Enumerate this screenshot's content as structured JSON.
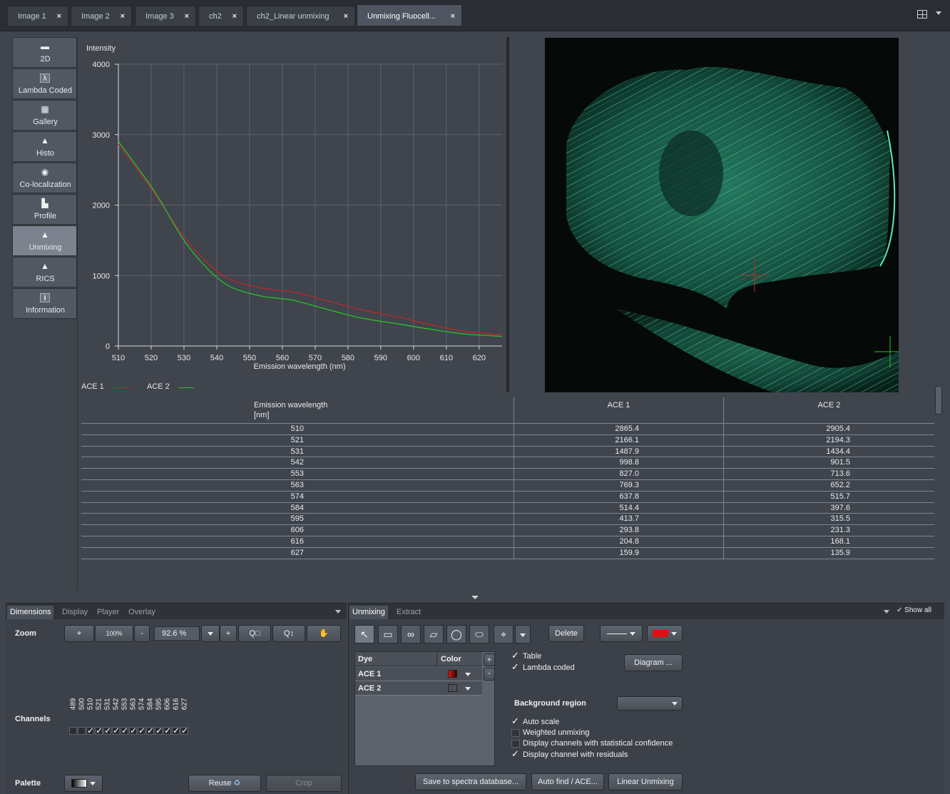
{
  "tabs": [
    {
      "label": "Image 1",
      "close": "×"
    },
    {
      "label": "Image 2",
      "close": "×"
    },
    {
      "label": "Image 3",
      "close": "×"
    },
    {
      "label": "ch2",
      "close": "×"
    },
    {
      "label": "ch2_Linear unmixing",
      "close": "×"
    },
    {
      "label": "Unmixing Fluocell...",
      "close": "×"
    }
  ],
  "view_tabs": [
    {
      "label": "2D",
      "icon": "▬"
    },
    {
      "label": "Lambda Coded",
      "icon": "λ"
    },
    {
      "label": "Gallery",
      "icon": "▦"
    },
    {
      "label": "Histo",
      "icon": "▲"
    },
    {
      "label": "Co-localization",
      "icon": "◉"
    },
    {
      "label": "Profile",
      "icon": "▙"
    },
    {
      "label": "Unmixing",
      "icon": "▲"
    },
    {
      "label": "RICS",
      "icon": "▲"
    },
    {
      "label": "Information",
      "icon": "i"
    }
  ],
  "chart_data": {
    "type": "line",
    "ylabel": "Intensity",
    "xlabel": "Emission wavelength (nm)",
    "xlim": [
      510,
      627
    ],
    "ylim": [
      0,
      4000
    ],
    "xticks": [
      510,
      520,
      530,
      540,
      550,
      560,
      570,
      580,
      590,
      600,
      610,
      620
    ],
    "yticks": [
      0,
      1000,
      2000,
      3000,
      4000
    ],
    "grid": true,
    "legend": "bottom-left",
    "x": [
      510,
      521,
      531,
      542,
      553,
      563,
      574,
      584,
      595,
      606,
      616,
      627
    ],
    "series": [
      {
        "name": "ACE 1",
        "color": "#c0262c",
        "values": [
          2865.4,
          2166.1,
          1487.9,
          998.8,
          827.0,
          769.3,
          637.8,
          514.4,
          413.7,
          293.8,
          204.8,
          159.9
        ]
      },
      {
        "name": "ACE 2",
        "color": "#27c227",
        "values": [
          2905.4,
          2194.3,
          1434.4,
          901.5,
          713.6,
          652.2,
          515.7,
          397.6,
          315.5,
          231.3,
          168.1,
          135.9
        ]
      }
    ]
  },
  "table": {
    "headers": [
      "Emission wavelength",
      "[nm]",
      "ACE 1",
      "ACE 2"
    ],
    "rows": [
      [
        "510",
        "2865.4",
        "2905.4"
      ],
      [
        "521",
        "2166.1",
        "2194.3"
      ],
      [
        "531",
        "1487.9",
        "1434.4"
      ],
      [
        "542",
        "998.8",
        "901.5"
      ],
      [
        "553",
        "827.0",
        "713.6"
      ],
      [
        "563",
        "769.3",
        "652.2"
      ],
      [
        "574",
        "637.8",
        "515.7"
      ],
      [
        "584",
        "514.4",
        "397.6"
      ],
      [
        "595",
        "413.7",
        "315.5"
      ],
      [
        "606",
        "293.8",
        "231.3"
      ],
      [
        "616",
        "204.8",
        "168.1"
      ],
      [
        "627",
        "159.9",
        "135.9"
      ]
    ]
  },
  "left_panel": {
    "tabs": [
      "Dimensions",
      "Display",
      "Player",
      "Overlay"
    ],
    "zoom_label": "Zoom",
    "zoom_100": "100%",
    "zoom_minus": "-",
    "zoom_value": "92.6 %",
    "zoom_plus": "+",
    "channels_label": "Channels",
    "channels": [
      {
        "nm": "489",
        "checked": false
      },
      {
        "nm": "500",
        "checked": false
      },
      {
        "nm": "510",
        "checked": true
      },
      {
        "nm": "521",
        "checked": true
      },
      {
        "nm": "531",
        "checked": true
      },
      {
        "nm": "542",
        "checked": true
      },
      {
        "nm": "553",
        "checked": true
      },
      {
        "nm": "563",
        "checked": true
      },
      {
        "nm": "574",
        "checked": true
      },
      {
        "nm": "584",
        "checked": true
      },
      {
        "nm": "595",
        "checked": true
      },
      {
        "nm": "606",
        "checked": true
      },
      {
        "nm": "616",
        "checked": true
      },
      {
        "nm": "627",
        "checked": true
      }
    ],
    "palette_label": "Palette",
    "reuse_label": "Reuse",
    "crop_label": "Crop"
  },
  "right_panel": {
    "tabs": [
      "Unmixing",
      "Extract"
    ],
    "show_all": "Show all",
    "delete_label": "Delete",
    "dye_header": "Dye",
    "color_header": "Color",
    "add": "+",
    "remove": "-",
    "dyes": [
      {
        "name": "ACE 1",
        "color": "#d11a1a"
      },
      {
        "name": "ACE 2",
        "color": "#1fc31f"
      }
    ],
    "table_cb": "Table",
    "lambda_cb": "Lambda coded",
    "diagram_btn": "Diagram ...",
    "background_region": "Background region",
    "auto_scale": "Auto scale",
    "weighted": "Weighted unmixing",
    "stat_conf": "Display channels with statistical confidence",
    "residuals": "Display channel with residuals",
    "save_btn": "Save to spectra database...",
    "autofind_btn": "Auto find / ACE...",
    "linear_btn": "Linear Unmixing",
    "line_color": "#e01010"
  }
}
